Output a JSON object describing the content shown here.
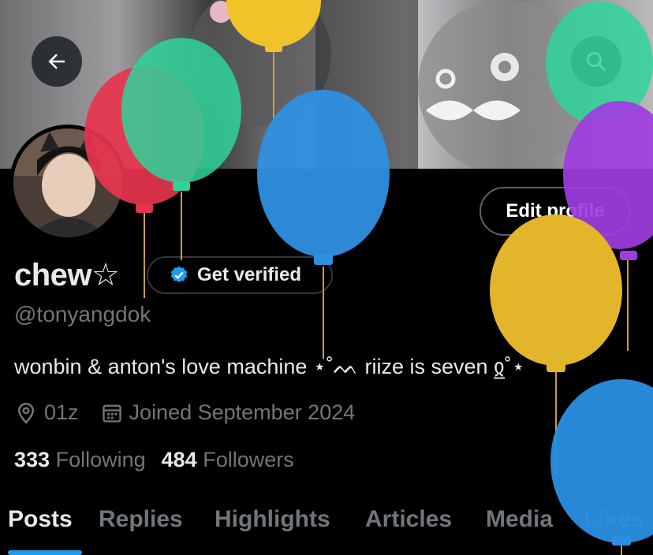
{
  "header": {
    "back_icon": "arrow-left-icon",
    "search_icon": "search-icon"
  },
  "profile": {
    "display_name": "chew☆",
    "handle": "@tonyangdok",
    "edit_label": "Edit profile",
    "verify_label": "Get verified",
    "bio": "wonbin & anton's love machine ⋆˚ᨓ riize is seven ჲ̲˚⋆",
    "location": "01z",
    "joined": "Joined September 2024",
    "following_count": "333",
    "following_label": "Following",
    "followers_count": "484",
    "followers_label": "Followers"
  },
  "tabs": [
    {
      "label": "Posts",
      "active": true
    },
    {
      "label": "Replies"
    },
    {
      "label": "Highlights"
    },
    {
      "label": "Articles"
    },
    {
      "label": "Media"
    },
    {
      "label": "Likes"
    }
  ],
  "colors": {
    "accent": "#1d9bf0",
    "muted_text": "#71767b",
    "balloons": [
      "#e8344e",
      "#2fd49a",
      "#f2c22a",
      "#2f8fe0",
      "#a03de0",
      "#e3b52b",
      "#2a8fe4"
    ]
  }
}
